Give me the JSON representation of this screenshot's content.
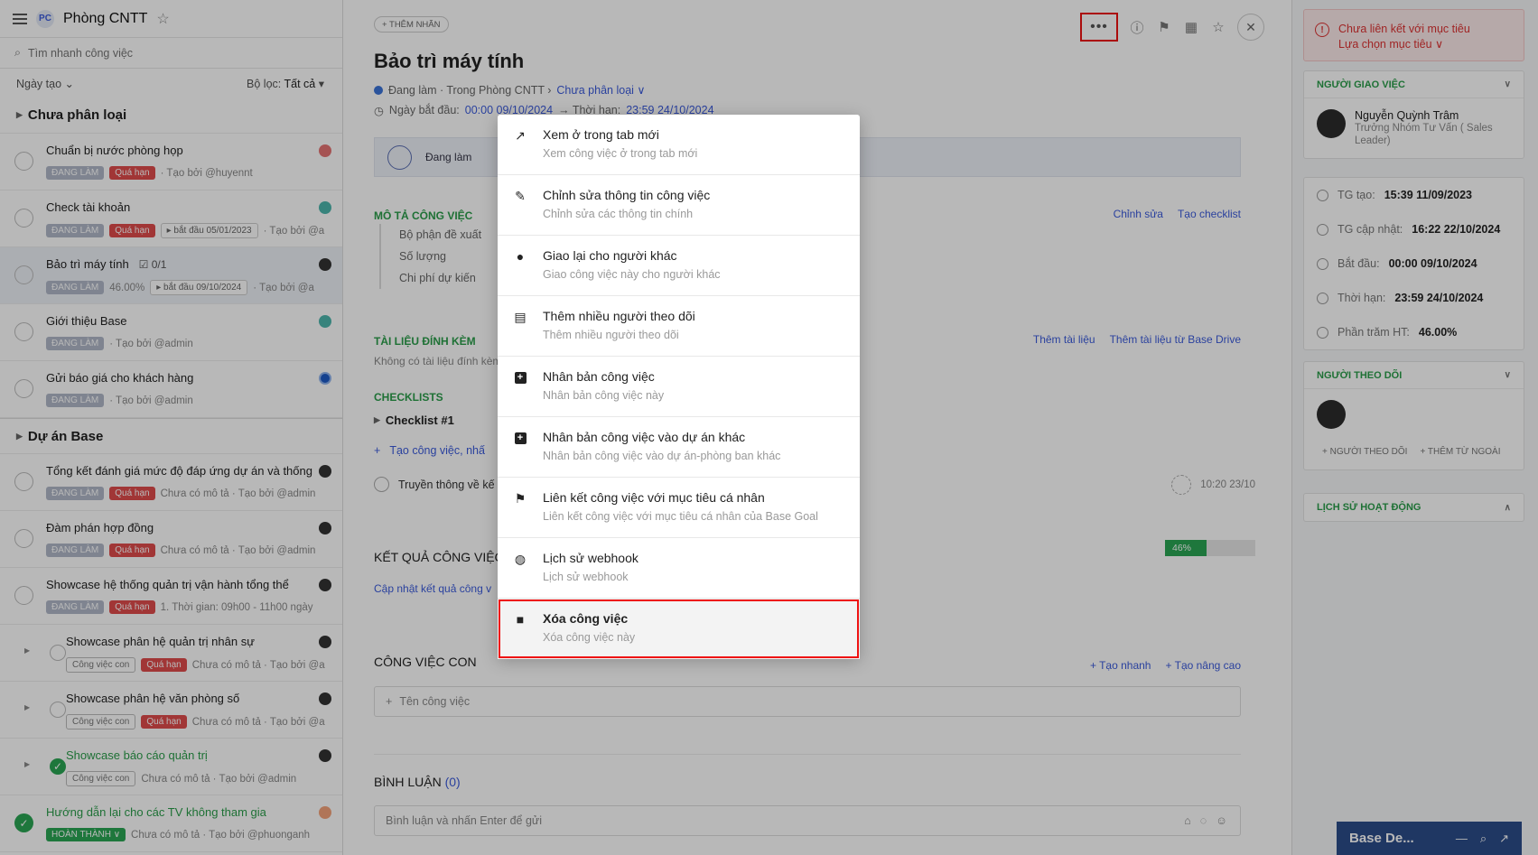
{
  "left": {
    "title": "Phòng CNTT",
    "project_icon_text": "PC",
    "search_placeholder": "Tìm nhanh công việc",
    "sort_label": "Ngày tạo",
    "filter_label": "Bộ lọc:",
    "filter_value": "Tất cả",
    "sections": [
      {
        "name": "Chưa phân loại",
        "tasks": [
          {
            "title": "Chuẩn bị nước phòng họp",
            "status": "ĐANG LÀM",
            "late": "Quá hạn",
            "extra": "",
            "by": "· Tạo bởi @huyennt"
          },
          {
            "title": "Check tài khoản",
            "status": "ĐANG LÀM",
            "late": "Quá hạn",
            "extra": "▸ bắt đầu 05/01/2023",
            "by": "· Tạo bởi @a"
          },
          {
            "title": "Bảo trì máy tính",
            "checklist": "☑ 0/1",
            "status": "ĐANG LÀM",
            "pct": "46.00%",
            "extra": "▸ bắt đầu 09/10/2024",
            "by": "· Tạo bởi @a"
          },
          {
            "title": "Giới thiệu Base",
            "status": "ĐANG LÀM",
            "by": "· Tạo bởi @admin"
          },
          {
            "title": "Gửi báo giá cho khách hàng",
            "status": "ĐANG LÀM",
            "by": "· Tạo bởi @admin"
          }
        ]
      },
      {
        "name": "Dự án Base",
        "tasks": [
          {
            "title": "Tổng kết đánh giá mức độ đáp ứng dự án và thống",
            "status": "ĐANG LÀM",
            "late": "Quá hạn",
            "by": "Chưa có mô tả · Tạo bởi @admin"
          },
          {
            "title": "Đàm phán hợp đồng",
            "status": "ĐANG LÀM",
            "late": "Quá hạn",
            "by": "Chưa có mô tả · Tạo bởi @admin"
          },
          {
            "title": "Showcase hệ thống quản trị vận hành tổng thể",
            "status": "ĐANG LÀM",
            "late": "Quá hạn",
            "by": "1. Thời gian: 09h00 - 11h00 ngày"
          },
          {
            "title": "Showcase phân hệ quản trị nhân sự",
            "status": "Công việc con",
            "late": "Quá hạn",
            "by": "Chưa có mô tả · Tạo bởi @a"
          },
          {
            "title": "Showcase phân hệ văn phòng số",
            "status": "Công việc con",
            "late": "Quá hạn",
            "by": "Chưa có mô tả · Tạo bởi @a"
          },
          {
            "title": "Showcase báo cáo quản trị",
            "status": "Công việc con",
            "by": "Chưa có mô tả · Tạo bởi @admin"
          },
          {
            "title": "Hướng dẫn lại cho các TV không tham gia",
            "status": "HOÀN THÀNH ∨",
            "by": "Chưa có mô tả · Tạo bởi @phuonganh"
          }
        ]
      }
    ]
  },
  "main": {
    "add_tag": "+ THÊM NHÃN",
    "more_label": "•••",
    "title": "Bảo trì máy tính",
    "status_text": "Đang làm · Trong Phòng CNTT ›",
    "category": "Chưa phân loại ∨",
    "start_label": "Ngày bắt đầu:",
    "start_value": "00:00 09/10/2024",
    "due_label": "→  Thời hạn:",
    "due_value": "23:59 24/10/2024",
    "progress_status": "Đang làm",
    "desc_label": "MÔ TẢ CÔNG VIỆC",
    "desc_edit": "Chỉnh sửa",
    "desc_checklist": "Tạo checklist",
    "fields": [
      "Bộ phận đề xuất",
      "Số lượng",
      "Chi phí dự kiến"
    ],
    "attach_label": "TÀI LIỆU ĐÍNH KÈM",
    "attach_add": "Thêm tài liệu",
    "attach_drive": "Thêm tài liệu từ Base Drive",
    "attach_empty": "Không có tài liệu đính kèm",
    "checklists_label": "CHECKLISTS",
    "checklist_name": "Checklist #1",
    "checklist_add": "Tạo công việc, nhấ",
    "checklist_item": "Truyền thông về kế",
    "checklist_time": "10:20 23/10",
    "result_label": "KẾT QUẢ CÔNG VIỆC",
    "result_pct": "46%",
    "result_pct_value": 46,
    "result_update": "Cập nhật kết quả công v",
    "sub_label": "CÔNG VIỆC CON",
    "sub_quick": "+ Tạo nhanh",
    "sub_adv": "+ Tạo nâng cao",
    "sub_placeholder": "Tên công việc",
    "comment_label": "BÌNH LUẬN",
    "comment_count": "(0)",
    "comment_placeholder": "Bình luận và nhấn Enter để gửi"
  },
  "right": {
    "warn_title": "Chưa liên kết với mục tiêu",
    "warn_action": "Lựa chọn mục tiêu ∨",
    "assigner_label": "NGƯỜI GIAO VIỆC",
    "assigner_name": "Nguyễn Quỳnh Trâm",
    "assigner_role": "Trưởng Nhóm Tư Vấn ( Sales Leader)",
    "info": [
      {
        "label": "TG tạo:",
        "value": "15:39 11/09/2023"
      },
      {
        "label": "TG cập nhật:",
        "value": "16:22 22/10/2024"
      },
      {
        "label": "Bắt đầu:",
        "value": "00:00 09/10/2024"
      },
      {
        "label": "Thời hạn:",
        "value": "23:59 24/10/2024"
      },
      {
        "label": "Phần trăm HT:",
        "value": "46.00%"
      }
    ],
    "followers_label": "NGƯỜI THEO DÕI",
    "add_follower": "+ NGƯỜI THEO DÕI",
    "add_external": "+ THÊM TỪ NGOÀI",
    "history_label": "LỊCH SỬ HOẠT ĐỘNG",
    "base_desk": "Base De..."
  },
  "menu": {
    "items": [
      {
        "title": "Xem ở trong tab mới",
        "sub": "Xem công việc ở trong tab mới"
      },
      {
        "title": "Chỉnh sửa thông tin công việc",
        "sub": "Chỉnh sửa các thông tin chính"
      },
      {
        "title": "Giao lại cho người khác",
        "sub": "Giao công việc này cho người khác"
      },
      {
        "title": "Thêm nhiều người theo dõi",
        "sub": "Thêm nhiều người theo dõi"
      },
      {
        "title": "Nhân bản công việc",
        "sub": "Nhân bản công việc này"
      },
      {
        "title": "Nhân bản công việc vào dự án khác",
        "sub": "Nhân bản công việc vào dự án-phòng ban khác"
      },
      {
        "title": "Liên kết công việc với mục tiêu cá nhân",
        "sub": "Liên kết công việc với mục tiêu cá nhân của Base Goal"
      },
      {
        "title": "Lịch sử webhook",
        "sub": "Lịch sử webhook"
      },
      {
        "title": "Xóa công việc",
        "sub": "Xóa công việc này"
      }
    ]
  }
}
